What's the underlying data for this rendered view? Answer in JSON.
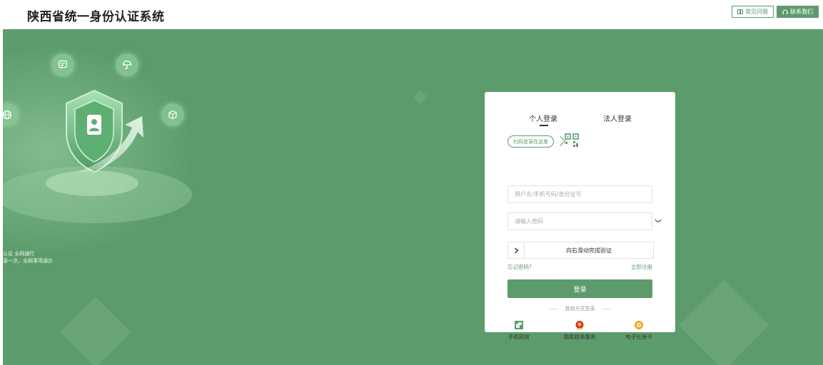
{
  "header": {
    "title": "陕西省统一身份认证系统",
    "faq_label": "常见问题",
    "contact_label": "联系我们"
  },
  "banner": {
    "slogan_line1": "认证 全网通行",
    "slogan_line2": "录一次，全网事项通办"
  },
  "login": {
    "tabs": [
      {
        "label": "个人登录",
        "active": true
      },
      {
        "label": "法人登录",
        "active": false
      }
    ],
    "qr_tip": "扫码登录在这里",
    "username_placeholder": "用户名/手机号码/身份证号",
    "password_placeholder": "请输入密码",
    "slider_text": "向右滑动完成验证",
    "forgot_label": "忘记密码?",
    "register_label": "立即注册",
    "submit_label": "登录",
    "other_label": "其他方式登录",
    "methods": [
      {
        "label": "手机短信",
        "icon": "sms-icon"
      },
      {
        "label": "国家政务服务",
        "icon": "national-emblem-icon"
      },
      {
        "label": "电子社保卡",
        "icon": "social-security-card-icon"
      }
    ]
  },
  "colors": {
    "brand": "#5c9c6c",
    "accent_orange": "#f5a623",
    "emblem_red": "#d9302c"
  }
}
